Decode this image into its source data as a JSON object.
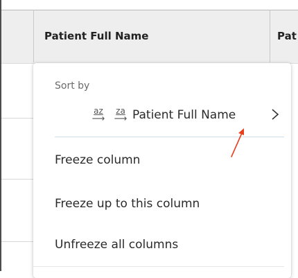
{
  "grid": {
    "columns": [
      {
        "header": "Patient Full Name"
      },
      {
        "header": "Pat"
      }
    ]
  },
  "column_menu": {
    "sort": {
      "label": "Sort by",
      "ascending_glyph": "az",
      "descending_glyph": "za",
      "field": "Patient Full Name"
    },
    "items": [
      {
        "label": "Freeze column"
      },
      {
        "label": "Freeze up to this column"
      },
      {
        "label": "Unfreeze all columns"
      }
    ]
  },
  "annotation": {
    "color": "#e8401c"
  },
  "colors": {
    "menu_divider_accent": "#cfe0ee",
    "header_background": "#eeeeee"
  }
}
